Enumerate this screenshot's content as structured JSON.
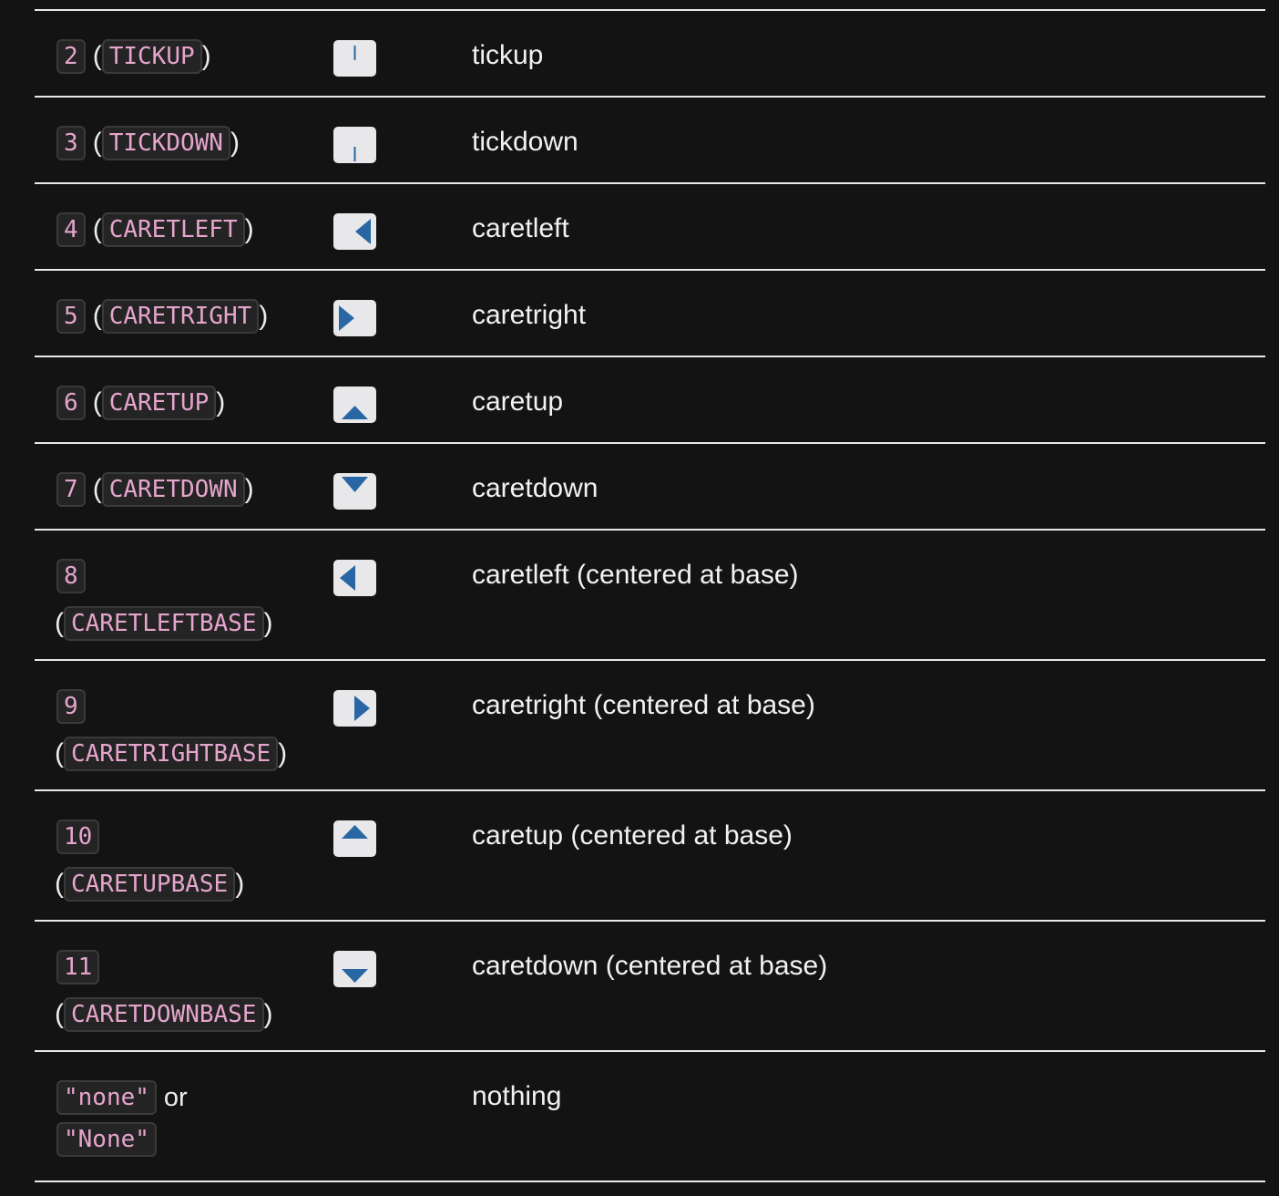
{
  "rows": [
    {
      "num": "2",
      "name": "TICKUP",
      "marker": "tickup",
      "desc": "tickup"
    },
    {
      "num": "3",
      "name": "TICKDOWN",
      "marker": "tickdown",
      "desc": "tickdown"
    },
    {
      "num": "4",
      "name": "CARETLEFT",
      "marker": "caretleft",
      "desc": "caretleft"
    },
    {
      "num": "5",
      "name": "CARETRIGHT",
      "marker": "caretright",
      "desc": "caretright"
    },
    {
      "num": "6",
      "name": "CARETUP",
      "marker": "caretup",
      "desc": "caretup"
    },
    {
      "num": "7",
      "name": "CARETDOWN",
      "marker": "caretdown",
      "desc": "caretdown"
    },
    {
      "num": "8",
      "name": "CARETLEFTBASE",
      "marker": "caretleftbase",
      "desc": "caretleft (centered at base)"
    },
    {
      "num": "9",
      "name": "CARETRIGHTBASE",
      "marker": "caretrightbase",
      "desc": "caretright (centered at base)"
    },
    {
      "num": "10",
      "name": "CARETUPBASE",
      "marker": "caretupbase",
      "desc": "caretup (centered at base)"
    },
    {
      "num": "11",
      "name": "CARETDOWNBASE",
      "marker": "caretdownbase",
      "desc": "caretdown (centered at base)"
    }
  ],
  "last": {
    "code1": "\"none\"",
    "or": "or",
    "code2": "\"None\"",
    "desc": "nothing"
  },
  "colors": {
    "marker_bg": "#e8e8ea",
    "marker_fg": "#2867a4",
    "code_text": "#e5a5cc"
  }
}
